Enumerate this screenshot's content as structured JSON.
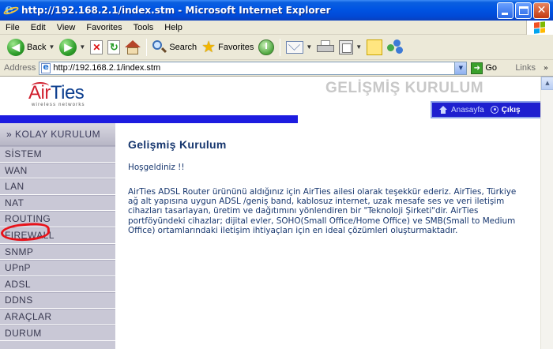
{
  "window": {
    "title": "http://192.168.2.1/index.stm - Microsoft Internet Explorer"
  },
  "menu": [
    "File",
    "Edit",
    "View",
    "Favorites",
    "Tools",
    "Help"
  ],
  "toolbar": {
    "back_label": "Back",
    "search_label": "Search",
    "favorites_label": "Favorites"
  },
  "address": {
    "label": "Address",
    "url": "http://192.168.2.1/index.stm",
    "go_label": "Go",
    "links_label": "Links"
  },
  "page": {
    "logo_text_ai": "Air",
    "logo_text_ties": "Ties",
    "logo_tagline": "wireless networks",
    "header_title": "GELİŞMİŞ KURULUM",
    "nav_home": "Anasayfa",
    "nav_exit": "Çıkış",
    "sidebar_head": "» KOLAY KURULUM",
    "sidebar_items": [
      "SİSTEM",
      "WAN",
      "LAN",
      "NAT",
      "ROUTING",
      "FIREWALL",
      "SNMP",
      "UPnP",
      "ADSL",
      "DDNS",
      "ARAÇLAR",
      "DURUM"
    ],
    "content_title": "Gelişmiş Kurulum",
    "greeting": "Hoşgeldiniz !!",
    "body_lines": [
      "AirTies ADSL Router ürününü aldığınız için AirTies ailesi olarak teşekkür ederiz. AirTies, Türkiye",
      "ağ alt yapısına uygun ADSL /geniş band, kablosuz internet, uzak mesafe ses ve veri iletişim",
      "cihazları tasarlayan, üretim ve dağıtımını yönlendiren bir \"Teknoloji Şirketi\"dir. AirTies",
      "portföyündeki cihazlar; dijital evler, SOHO(Small Office/Home Office) ve SMB(Small to Medium",
      "Office) ortamlarındaki iletişim ihtiyaçları için en ideal çözümleri oluşturmaktadır."
    ]
  },
  "colors": {
    "titlebar": "#0054e3",
    "sidebar_bg": "#c9c8d6",
    "nav_blue": "#1d1ce0",
    "content_text": "#16366e",
    "highlight_red": "#e8121a"
  }
}
